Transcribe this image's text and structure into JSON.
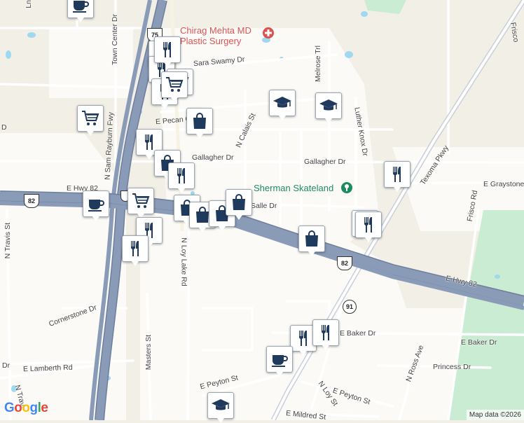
{
  "map": {
    "attribution": "Map data ©2026",
    "logo": "Google",
    "road_labels": [
      {
        "id": "town-center-dr",
        "text": "Town Center Dr",
        "vertical": true
      },
      {
        "id": "n-sam-rayburn-fwy",
        "text": "N Sam Rayburn Fwy",
        "vertical": true
      },
      {
        "id": "sara-swamy-dr",
        "text": "Sara Swamy Dr"
      },
      {
        "id": "e-pecan",
        "text": "E Pecan G"
      },
      {
        "id": "gallagher-dr-west",
        "text": "Gallagher Dr"
      },
      {
        "id": "gallagher-dr-east",
        "text": "Gallagher Dr"
      },
      {
        "id": "n-calais-st",
        "text": "N Calais St"
      },
      {
        "id": "melrose-trl",
        "text": "Melrose Trl"
      },
      {
        "id": "luther-knox-dr",
        "text": "Luther Knox Dr"
      },
      {
        "id": "texoma-pkwy",
        "text": "Texoma Pkwy"
      },
      {
        "id": "frisco-rd-south",
        "text": "Frisco Rd"
      },
      {
        "id": "frisco-north",
        "text": "Frisco"
      },
      {
        "id": "e-graystone",
        "text": "E Graystone"
      },
      {
        "id": "e-hwy-82-west",
        "text": "E Hwy 82"
      },
      {
        "id": "e-hwy-82-east",
        "text": "E Hwy 82"
      },
      {
        "id": "salle-dr",
        "text": "Salle Dr"
      },
      {
        "id": "n-travis-st",
        "text": "N Travis St",
        "vertical": true
      },
      {
        "id": "n-loy-lake-rd",
        "text": "N Loy Lake Rd",
        "vertical": true
      },
      {
        "id": "cornerstone-dr",
        "text": "Cornerstone Dr"
      },
      {
        "id": "masters-st",
        "text": "Masters St",
        "vertical": true
      },
      {
        "id": "e-lamberth-rd",
        "text": "E Lamberth Rd"
      },
      {
        "id": "e-peyton-st-west",
        "text": "E Peyton St"
      },
      {
        "id": "e-peyton-st-east",
        "text": "E Peyton St"
      },
      {
        "id": "n-loy-st",
        "text": "N Loy St"
      },
      {
        "id": "e-baker-dr-west",
        "text": "E Baker Dr"
      },
      {
        "id": "e-baker-dr-east",
        "text": "E Baker Dr"
      },
      {
        "id": "n-ross-ave",
        "text": "N Ross Ave"
      },
      {
        "id": "princess-dr",
        "text": "Princess Dr"
      },
      {
        "id": "e-mildred-st",
        "text": "E Mildred St"
      },
      {
        "id": "n-travis-bottom",
        "text": "N Travi"
      },
      {
        "id": "ln-top",
        "text": "Ln"
      },
      {
        "id": "n-loy-top",
        "text": "N L"
      },
      {
        "id": "dr-left",
        "text": "Dr"
      },
      {
        "id": "d-left",
        "text": "D"
      }
    ],
    "places": [
      {
        "id": "mehta-line1",
        "text": "Chirag Mehta MD",
        "color": "#d9534f"
      },
      {
        "id": "mehta-line2",
        "text": "Plastic Surgery",
        "color": "#d9534f"
      },
      {
        "id": "sherman-skateland",
        "text": "Sherman Skateland",
        "color": "#1e8a62"
      }
    ],
    "shields": [
      {
        "id": "us-75",
        "text": "75",
        "kind": "us"
      },
      {
        "id": "us-82-west",
        "text": "82",
        "kind": "us"
      },
      {
        "id": "us-82-east",
        "text": "82",
        "kind": "us"
      },
      {
        "id": "sh-91",
        "text": "91",
        "kind": "state"
      },
      {
        "id": "shield-left-small",
        "text": "",
        "kind": "us"
      }
    ],
    "pins": [
      {
        "icon": "cafe"
      },
      {
        "icon": "restaurant"
      },
      {
        "icon": "restaurant"
      },
      {
        "icon": "shopping-cart"
      },
      {
        "icon": "restaurant"
      },
      {
        "icon": "shopping-cart"
      },
      {
        "icon": "school"
      },
      {
        "icon": "school"
      },
      {
        "icon": "shopping-bag"
      },
      {
        "icon": "restaurant"
      },
      {
        "icon": "shopping-bag"
      },
      {
        "icon": "restaurant"
      },
      {
        "icon": "restaurant"
      },
      {
        "icon": "shopping-cart"
      },
      {
        "icon": "cafe"
      },
      {
        "icon": "restaurant"
      },
      {
        "icon": "shopping-bag"
      },
      {
        "icon": "shopping-bag"
      },
      {
        "icon": "shopping-bag"
      },
      {
        "icon": "shopping-bag"
      },
      {
        "icon": "restaurant"
      },
      {
        "icon": "restaurant"
      },
      {
        "icon": "shopping-bag"
      },
      {
        "icon": "restaurant"
      },
      {
        "icon": "restaurant"
      },
      {
        "icon": "restaurant"
      },
      {
        "icon": "cafe"
      },
      {
        "icon": "school"
      },
      {
        "icon": "restaurant"
      },
      {
        "icon": "shopping-cart"
      }
    ],
    "colors": {
      "background": "#f2efe6",
      "urban": "#fbfaf6",
      "highway": "#8a9bb8",
      "highway_edge": "#6d7f9d",
      "road": "#ffffff",
      "park": "#c9ecd2",
      "water": "#9fd8f0",
      "pin_icon": "#1f3a5c",
      "hospital": "#d9534f"
    }
  }
}
